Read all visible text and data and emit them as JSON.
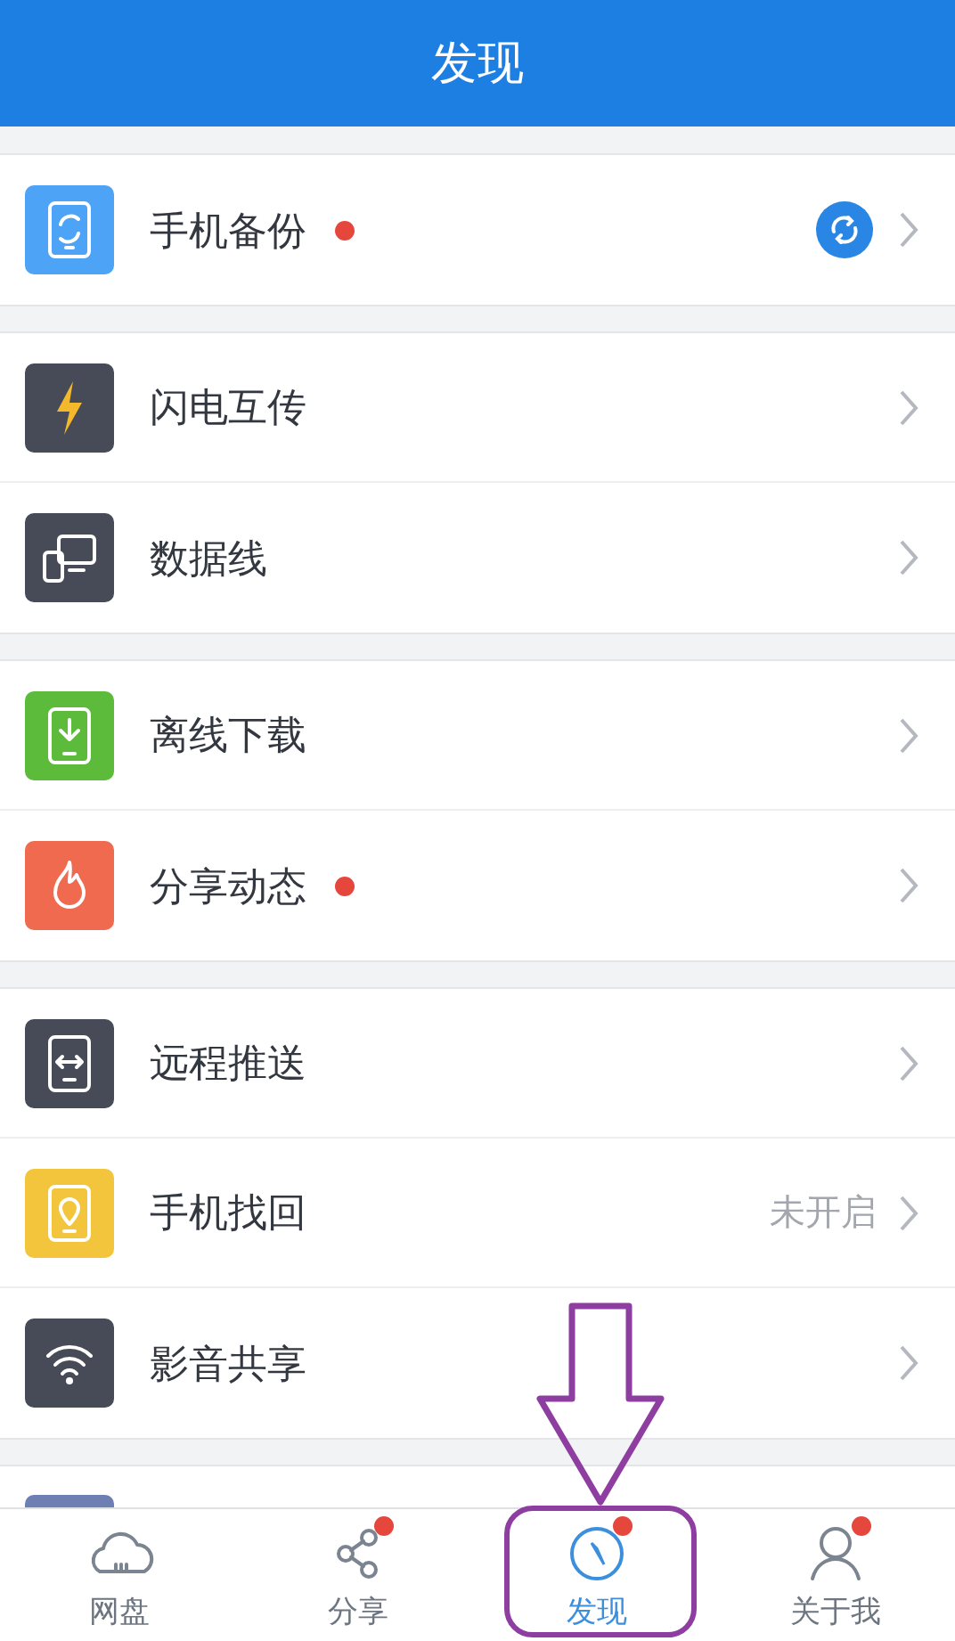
{
  "header": {
    "title": "发现"
  },
  "groups": [
    {
      "items": [
        {
          "kind": "backup",
          "label": "手机备份",
          "dot": true,
          "trailing": {
            "kind": "sync"
          }
        }
      ]
    },
    {
      "items": [
        {
          "kind": "flash",
          "label": "闪电互传",
          "dot": false
        },
        {
          "kind": "cable",
          "label": "数据线",
          "dot": false
        }
      ]
    },
    {
      "items": [
        {
          "kind": "download",
          "label": "离线下载",
          "dot": false
        },
        {
          "kind": "fire",
          "label": "分享动态",
          "dot": true
        }
      ]
    },
    {
      "items": [
        {
          "kind": "remote",
          "label": "远程推送",
          "dot": false
        },
        {
          "kind": "locate",
          "label": "手机找回",
          "dot": false,
          "trailing": {
            "kind": "text",
            "text": "未开启"
          }
        },
        {
          "kind": "wifi",
          "label": "影音共享",
          "dot": false
        }
      ]
    }
  ],
  "tabs": [
    {
      "kind": "cloud",
      "label": "网盘",
      "selected": false,
      "dot": false
    },
    {
      "kind": "share",
      "label": "分享",
      "selected": false,
      "dot": true
    },
    {
      "kind": "compass",
      "label": "发现",
      "selected": true,
      "dot": true
    },
    {
      "kind": "person",
      "label": "关于我",
      "selected": false,
      "dot": true
    }
  ]
}
